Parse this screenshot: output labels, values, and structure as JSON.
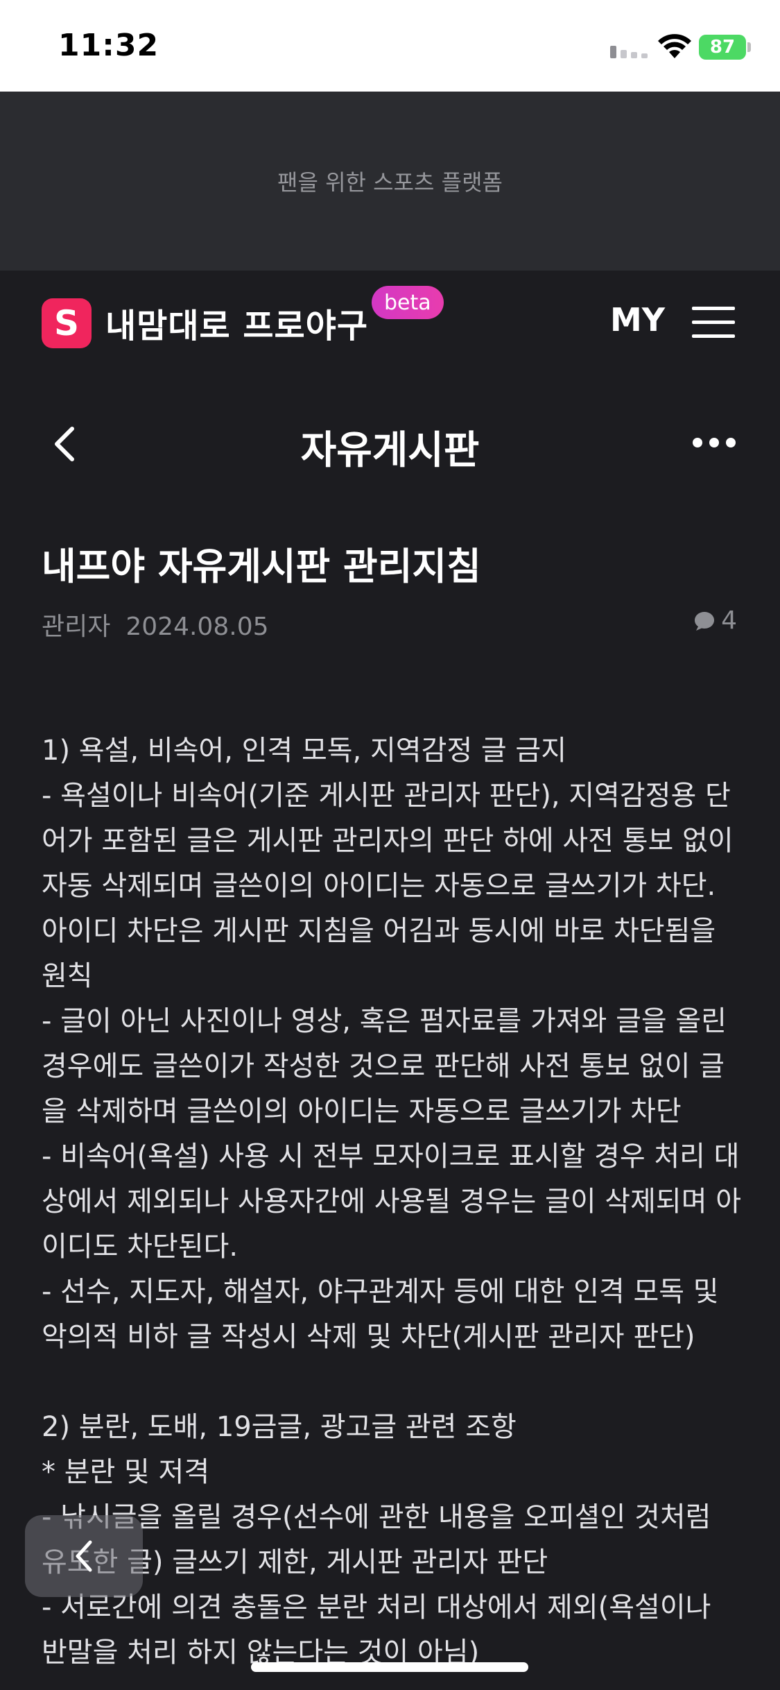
{
  "status_bar": {
    "time": "11:32",
    "battery": "87"
  },
  "banner": {
    "text": "팬을 위한 스포츠 플랫폼"
  },
  "header": {
    "logo_letter": "S",
    "brand": "내맘대로 프로야구",
    "badge": "beta",
    "my_label": "MY",
    "icons": [
      "logo-icon",
      "menu-icon"
    ]
  },
  "title_bar": {
    "title": "자유게시판",
    "icons": [
      "back-icon",
      "more-icon"
    ]
  },
  "post": {
    "title": "내프야 자유게시판 관리지침",
    "author": "관리자",
    "date": "2024.08.05",
    "comment_count": "4",
    "body": "1) 욕설, 비속어, 인격 모독, 지역감정 글 금지\n- 욕설이나 비속어(기준 게시판 관리자 판단), 지역감정용 단어가 포함된 글은 게시판 관리자의 판단 하에 사전 통보 없이 자동 삭제되며 글쓴이의 아이디는 자동으로 글쓰기가 차단. 아이디 차단은 게시판 지침을 어김과 동시에 바로 차단됨을 원칙\n- 글이 아닌 사진이나 영상, 혹은 펌자료를 가져와 글을 올린 경우에도 글쓴이가 작성한 것으로 판단해 사전 통보 없이 글을 삭제하며 글쓴이의 아이디는 자동으로 글쓰기가 차단\n- 비속어(욕설) 사용 시 전부 모자이크로 표시할 경우 처리 대상에서 제외되나 사용자간에 사용될 경우는 글이 삭제되며 아이디도 차단된다.\n- 선수, 지도자, 해설자, 야구관계자 등에 대한 인격 모독 및 악의적 비하 글 작성시 삭제 및 차단(게시판 관리자 판단)\n\n2) 분란, 도배, 19금글, 광고글 관련 조항\n* 분란 및 저격\n- 낚시글을 올릴 경우(선수에 관한 내용을 오피셜인 것처럼 유도한 글) 글쓰기 제한, 게시판 관리자 판단\n- 서로간에 의견 충돌은 분란 처리 대상에서 제외(욕설이나 반말을 처리 하지 않는다는 것이 아님)"
  },
  "colors": {
    "background": "#1c1c20",
    "banner": "#2b2c30",
    "brand_red": "#f0255d",
    "badge": "#e03ab8",
    "battery": "#4cd964"
  }
}
